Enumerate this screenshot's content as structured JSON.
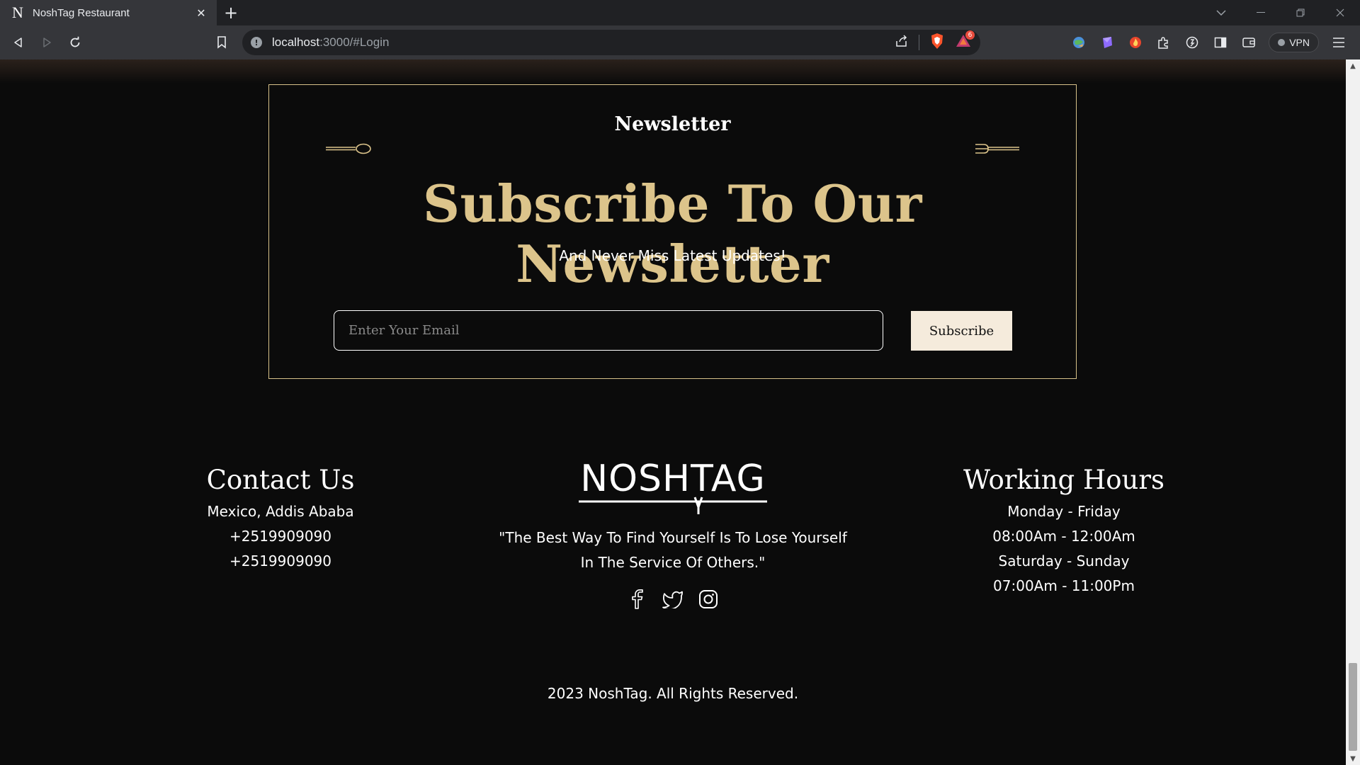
{
  "browser": {
    "tab_title": "NoshTag Restaurant",
    "tab_favicon": "N",
    "url_host": "localhost",
    "url_rest": ":3000/#Login",
    "vpn_label": "VPN",
    "notification_count": "6"
  },
  "newsletter": {
    "label": "Newsletter",
    "heading": "Subscribe To Our Newsletter",
    "subheading": "And Never Miss Latest Updates!",
    "email_placeholder": "Enter Your Email",
    "email_value": "",
    "subscribe_label": "Subscribe"
  },
  "footer": {
    "contact": {
      "title": "Contact Us",
      "lines": [
        "Mexico, Addis Ababa",
        "+2519909090",
        "+2519909090"
      ]
    },
    "logo_text": "NOSHTAG",
    "quote_line1": "\"The Best Way To Find Yourself Is To Lose Yourself",
    "quote_line2": "In The Service Of Others.\"",
    "social_icons": [
      "facebook-icon",
      "twitter-icon",
      "instagram-icon"
    ],
    "hours": {
      "title": "Working Hours",
      "lines": [
        "Monday - Friday",
        "08:00Am - 12:00Am",
        "Saturday - Sunday",
        "07:00Am - 11:00Pm"
      ]
    },
    "copyright": "2023 NoshTag. All Rights Reserved."
  },
  "colors": {
    "accent_gold": "#dcc48b",
    "page_background": "#0b0b0b",
    "button_cream": "#f5ebdc"
  }
}
